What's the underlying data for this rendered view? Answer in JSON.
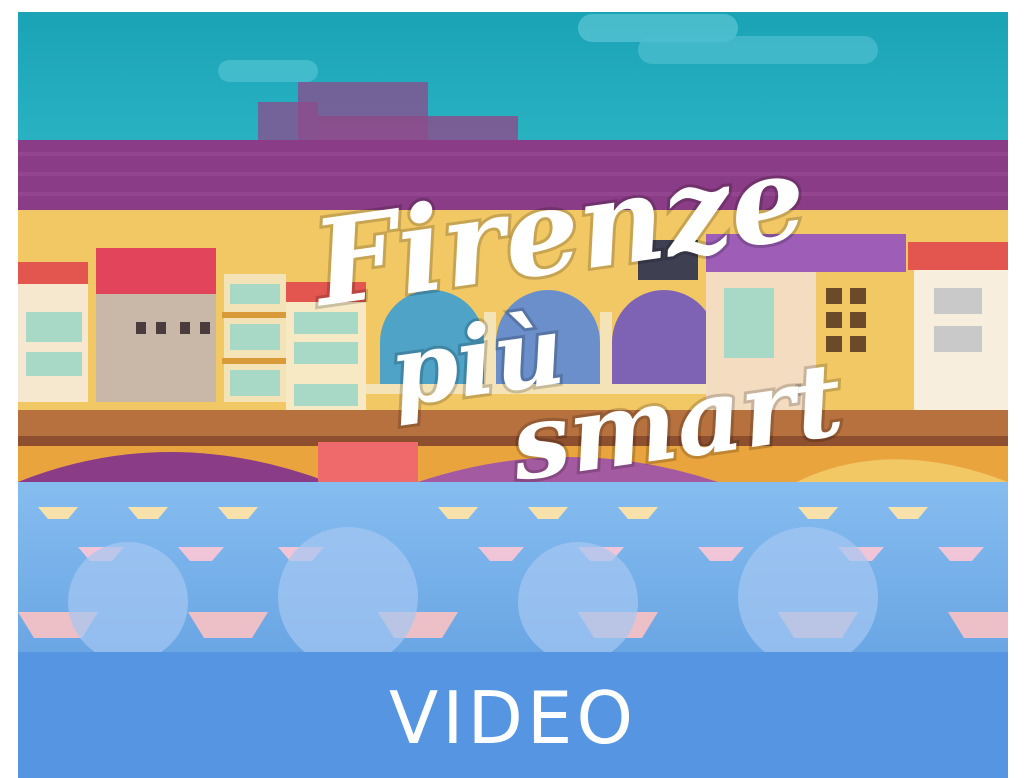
{
  "thumbnail": {
    "title_line1": "Firenze",
    "title_line2": "più",
    "title_line3": "smart"
  },
  "video_button": {
    "label": "VIDEO"
  },
  "colors": {
    "sky": "#1fa6b8",
    "roof": "#8a3c86",
    "bridge_yellow": "#f2c865",
    "river": "#7ab5ea",
    "button_blue": "#5595e2"
  }
}
